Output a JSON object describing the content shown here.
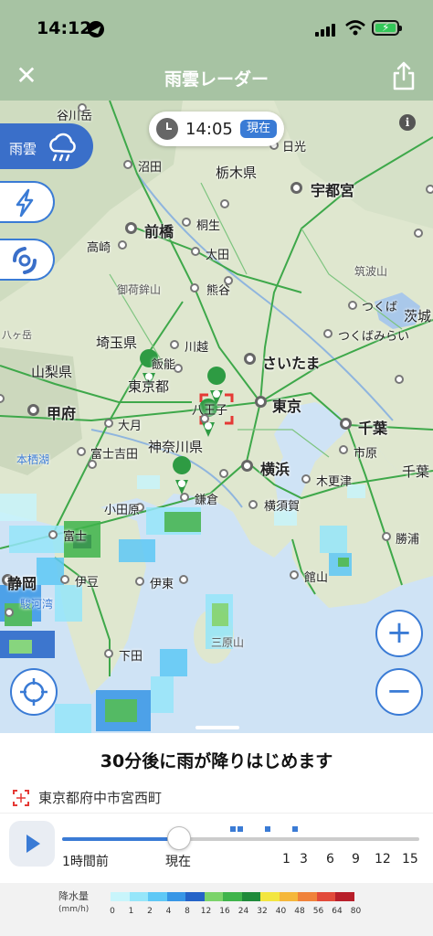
{
  "status_bar": {
    "time": "14:12"
  },
  "nav": {
    "title": "雨雲レーダー",
    "close_icon": "close-icon",
    "share_icon": "share-icon"
  },
  "map": {
    "time": "14:05",
    "now_label": "現在",
    "info_icon": "info-icon",
    "layers": {
      "rain_label": "雨雲",
      "rain_icon": "rain-cloud-icon",
      "thunder_icon": "lightning-icon",
      "typhoon_icon": "typhoon-icon"
    },
    "zoom_in": "+",
    "zoom_out": "−",
    "places": [
      {
        "name": "谷川岳"
      },
      {
        "name": "日光"
      },
      {
        "name": "沼田"
      },
      {
        "name": "栃木県"
      },
      {
        "name": "宇都宮"
      },
      {
        "name": "前橋"
      },
      {
        "name": "桐生"
      },
      {
        "name": "高崎"
      },
      {
        "name": "太田"
      },
      {
        "name": "御荷鉾山"
      },
      {
        "name": "熊谷"
      },
      {
        "name": "筑波山"
      },
      {
        "name": "茨城"
      },
      {
        "name": "つくば"
      },
      {
        "name": "つくばみらい"
      },
      {
        "name": "埼玉県"
      },
      {
        "name": "川越"
      },
      {
        "name": "飯能"
      },
      {
        "name": "さいたま"
      },
      {
        "name": "山梨県"
      },
      {
        "name": "東京都"
      },
      {
        "name": "甲府"
      },
      {
        "name": "八王子"
      },
      {
        "name": "東京"
      },
      {
        "name": "千葉"
      },
      {
        "name": "大月"
      },
      {
        "name": "神奈川県"
      },
      {
        "name": "富士吉田"
      },
      {
        "name": "本栖湖"
      },
      {
        "name": "横浜"
      },
      {
        "name": "市原"
      },
      {
        "name": "木更津"
      },
      {
        "name": "千葉"
      },
      {
        "name": "小田原"
      },
      {
        "name": "鎌倉"
      },
      {
        "name": "横須賀"
      },
      {
        "name": "富士"
      },
      {
        "name": "勝浦"
      },
      {
        "name": "静岡"
      },
      {
        "name": "伊豆"
      },
      {
        "name": "伊東"
      },
      {
        "name": "館山"
      },
      {
        "name": "三原山"
      },
      {
        "name": "下田"
      },
      {
        "name": "八ヶ岳"
      },
      {
        "name": "駿河湾"
      }
    ]
  },
  "panel": {
    "message": "30分後に雨が降りはじめます",
    "location": "東京都府中市宮西町",
    "location_icon": "location-marker-icon",
    "play_icon": "play-icon",
    "progress": 0.33,
    "timeline": [
      "1時間前",
      "現在",
      "1",
      "3",
      "6",
      "9",
      "12",
      "15"
    ],
    "legend_title": "降水量",
    "legend_unit": "(mm/h)",
    "legend_values": [
      "0",
      "1",
      "2",
      "4",
      "8",
      "12",
      "16",
      "24",
      "32",
      "40",
      "48",
      "56",
      "64",
      "80"
    ],
    "legend_colors": [
      "#c8f5fb",
      "#96e6fa",
      "#5ec8f6",
      "#3796e6",
      "#2463c8",
      "#7bd36a",
      "#3fb44b",
      "#1f8a3a",
      "#f3e640",
      "#f5b73a",
      "#f0823a",
      "#e24a3a",
      "#b81f2a"
    ]
  }
}
